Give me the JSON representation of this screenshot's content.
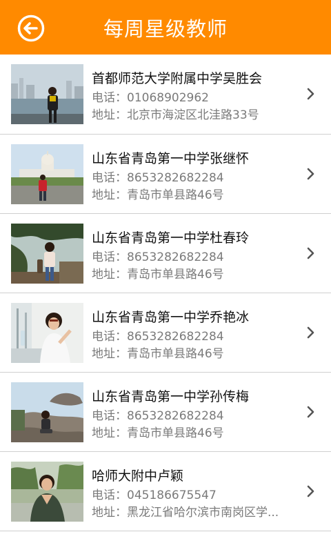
{
  "header": {
    "title": "每周星级教师",
    "back_icon": "back-arrow-circle-icon",
    "background": "#ff8a00"
  },
  "teachers": [
    {
      "name": "首都师范大学附属中学吴胜会",
      "phone": "电话：01068902962",
      "address": "地址：北京市海淀区北洼路33号"
    },
    {
      "name": "山东省青岛第一中学张继怀",
      "phone": "电话：8653282682284",
      "address": "地址：青岛市单县路46号"
    },
    {
      "name": "山东省青岛第一中学杜春玲",
      "phone": "电话：8653282682284",
      "address": "地址：青岛市单县路46号"
    },
    {
      "name": "山东省青岛第一中学乔艳冰",
      "phone": "电话：8653282682284",
      "address": "地址：青岛市单县路46号"
    },
    {
      "name": "山东省青岛第一中学孙传梅",
      "phone": "电话：8653282682284",
      "address": "地址：青岛市单县路46号"
    },
    {
      "name": "哈师大附中卢颖",
      "phone": "电话：045186675547",
      "address": "地址：黑龙江省哈尔滨市南岗区学..."
    }
  ]
}
